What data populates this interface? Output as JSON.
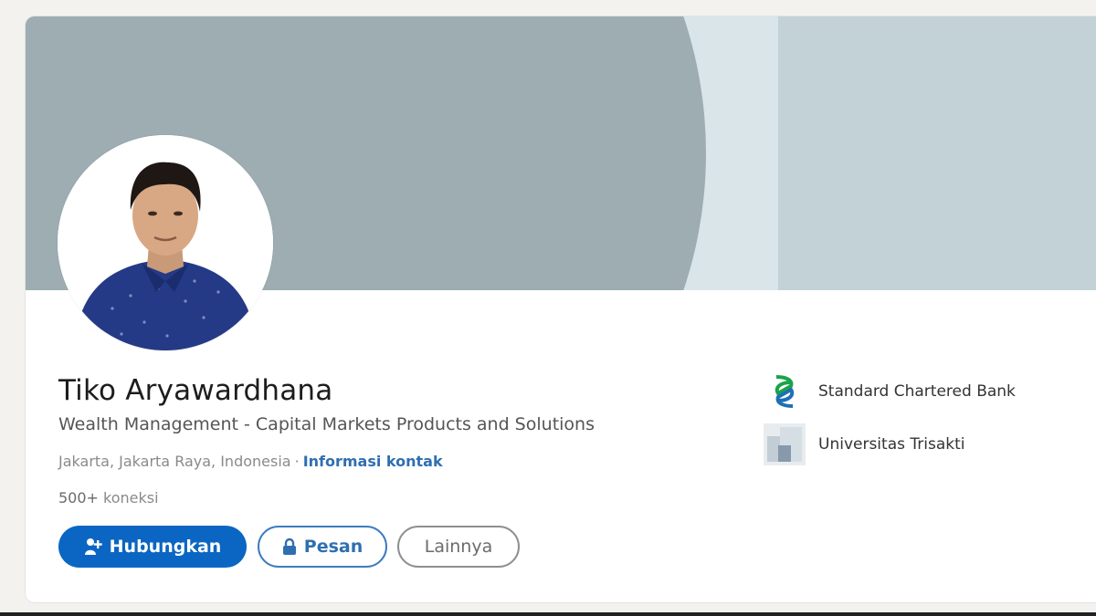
{
  "profile": {
    "name": "Tiko Aryawardhana",
    "headline": "Wealth Management - Capital Markets Products and Solutions",
    "location": "Jakarta, Jakarta Raya, Indonesia",
    "separator": "·",
    "contact_info_label": "Informasi kontak",
    "connections_count": "500+",
    "connections_label": "koneksi"
  },
  "actions": {
    "connect_label": "Hubungkan",
    "message_label": "Pesan",
    "more_label": "Lainnya"
  },
  "organizations": [
    {
      "name": "Standard Chartered Bank",
      "icon": "standard-chartered-logo"
    },
    {
      "name": "Universitas Trisakti",
      "icon": "university-logo"
    }
  ],
  "colors": {
    "primary": "#0a66c2",
    "link": "#2f6fb0",
    "banner_dark": "#9dadb2",
    "banner_light": "#c3d2d7"
  }
}
